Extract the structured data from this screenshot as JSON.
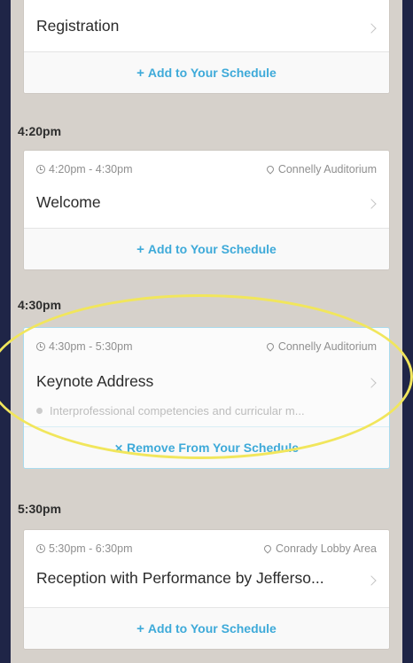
{
  "sessions": [
    {
      "title": "Registration",
      "action": {
        "symbol": "+",
        "label": "Add to Your Schedule"
      }
    },
    {
      "time_header": "4:20pm",
      "time_range": "4:20pm - 4:30pm",
      "location": "Connelly Auditorium",
      "title": "Welcome",
      "action": {
        "symbol": "+",
        "label": "Add to Your Schedule"
      }
    },
    {
      "time_header": "4:30pm",
      "time_range": "4:30pm - 5:30pm",
      "location": "Connelly Auditorium",
      "title": "Keynote Address",
      "topic": "Interprofessional competencies and curricular m...",
      "action": {
        "symbol": "✕",
        "label": "Remove From Your Schedule"
      }
    },
    {
      "time_header": "5:30pm",
      "time_range": "5:30pm - 6:30pm",
      "location": "Conrady Lobby Area",
      "title": "Reception with Performance by Jefferso...",
      "action": {
        "symbol": "+",
        "label": "Add to Your Schedule"
      }
    }
  ],
  "colors": {
    "accent": "#3eaad9",
    "highlight_oval": "#f1e65c",
    "frame": "#1f2547",
    "background": "#d6d1cb"
  }
}
